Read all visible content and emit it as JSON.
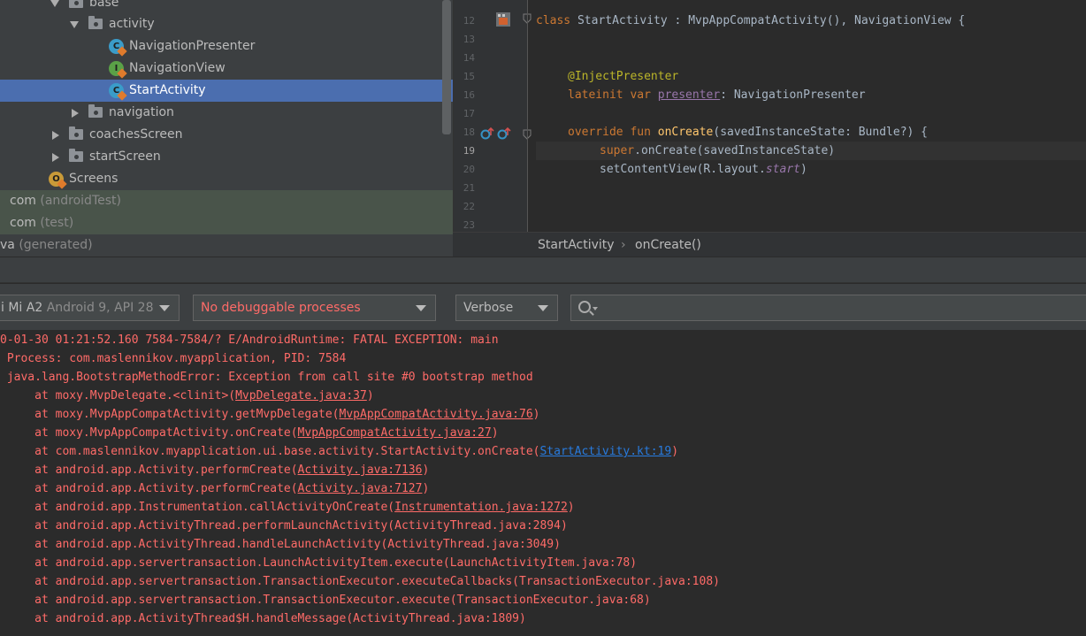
{
  "project_tree": {
    "rows": [
      {
        "label": "base",
        "suffix": "",
        "kind": "folder",
        "arrow": "down"
      },
      {
        "label": "activity",
        "suffix": "",
        "kind": "folder",
        "arrow": "down"
      },
      {
        "label": "NavigationPresenter",
        "suffix": "",
        "kind": "class"
      },
      {
        "label": "NavigationView",
        "suffix": "",
        "kind": "interface"
      },
      {
        "label": "StartActivity",
        "suffix": "",
        "kind": "class",
        "selected": true
      },
      {
        "label": "navigation",
        "suffix": "",
        "kind": "folder",
        "arrow": "right"
      },
      {
        "label": "coachesScreen",
        "suffix": "",
        "kind": "folder",
        "arrow": "right"
      },
      {
        "label": "startScreen",
        "suffix": "",
        "kind": "folder",
        "arrow": "right"
      },
      {
        "label": "Screens",
        "suffix": "",
        "kind": "object"
      },
      {
        "label": "com",
        "suffix": " (androidTest)",
        "kind": "package"
      },
      {
        "label": "com",
        "suffix": " (test)",
        "kind": "package"
      },
      {
        "label": "va",
        "suffix": " (generated)",
        "kind": "package"
      }
    ]
  },
  "editor": {
    "line_numbers": [
      "12",
      "13",
      "14",
      "15",
      "16",
      "17",
      "18",
      "19",
      "20",
      "21",
      "22",
      "23"
    ],
    "current_line": "19",
    "code": {
      "l12_a": "class ",
      "l12_b": "StartActivity : MvpAppCompatActivity(), NavigationView {",
      "l15": "@InjectPresenter",
      "l16_kw": "lateinit var ",
      "l16_name": "presenter",
      "l16_rest": ": NavigationPresenter",
      "l18_kw": "override fun ",
      "l18_fn": "onCreate",
      "l18_rest": "(savedInstanceState: Bundle?) {",
      "l19_kw": "super",
      "l19_a": ".",
      "l19_fn": "onCreate",
      "l19_rest": "(savedInstanceState)",
      "l20_a": "setContentView(R.layout.",
      "l20_prop": "start",
      "l20_b": ")"
    }
  },
  "breadcrumb": {
    "items": [
      "StartActivity",
      "onCreate()"
    ],
    "separator": "›"
  },
  "logcat": {
    "device": "i Mi A2",
    "device_detail": " Android 9, API 28",
    "process": "No debuggable processes",
    "level": "Verbose",
    "search_placeholder": "",
    "lines": [
      {
        "pre": "0-01-30 01:21:52.160 7584-7584/? E/AndroidRuntime: FATAL EXCEPTION: main",
        "link": "",
        "post": ""
      },
      {
        "pre": " Process: com.maslennikov.myapplication, PID: 7584",
        "link": "",
        "post": ""
      },
      {
        "pre": " java.lang.BootstrapMethodError: Exception from call site #0 bootstrap method",
        "link": "",
        "post": ""
      },
      {
        "pre": "     at moxy.MvpDelegate.<clinit>(",
        "link": "MvpDelegate.java:37",
        "post": ")"
      },
      {
        "pre": "     at moxy.MvpAppCompatActivity.getMvpDelegate(",
        "link": "MvpAppCompatActivity.java:76",
        "post": ")"
      },
      {
        "pre": "     at moxy.MvpAppCompatActivity.onCreate(",
        "link": "MvpAppCompatActivity.java:27",
        "post": ")"
      },
      {
        "pre": "     at com.maslennikov.myapplication.ui.base.activity.StartActivity.onCreate(",
        "link": "StartActivity.kt:19",
        "post": ")",
        "blue": true
      },
      {
        "pre": "     at android.app.Activity.performCreate(",
        "link": "Activity.java:7136",
        "post": ")"
      },
      {
        "pre": "     at android.app.Activity.performCreate(",
        "link": "Activity.java:7127",
        "post": ")"
      },
      {
        "pre": "     at android.app.Instrumentation.callActivityOnCreate(",
        "link": "Instrumentation.java:1272",
        "post": ")"
      },
      {
        "pre": "     at android.app.ActivityThread.performLaunchActivity(ActivityThread.java:2894)",
        "link": "",
        "post": ""
      },
      {
        "pre": "     at android.app.ActivityThread.handleLaunchActivity(ActivityThread.java:3049)",
        "link": "",
        "post": ""
      },
      {
        "pre": "     at android.app.servertransaction.LaunchActivityItem.execute(LaunchActivityItem.java:78)",
        "link": "",
        "post": ""
      },
      {
        "pre": "     at android.app.servertransaction.TransactionExecutor.executeCallbacks(TransactionExecutor.java:108)",
        "link": "",
        "post": ""
      },
      {
        "pre": "     at android.app.servertransaction.TransactionExecutor.execute(TransactionExecutor.java:68)",
        "link": "",
        "post": ""
      },
      {
        "pre": "     at android.app.ActivityThread$H.handleMessage(ActivityThread.java:1809)",
        "link": "",
        "post": ""
      }
    ]
  },
  "colors": {
    "selection": "#4b6eaf",
    "error_text": "#ff6b68",
    "keyword": "#cc7832",
    "annotation": "#bbb529",
    "function": "#ffc66d",
    "link_blue": "#287bde"
  }
}
